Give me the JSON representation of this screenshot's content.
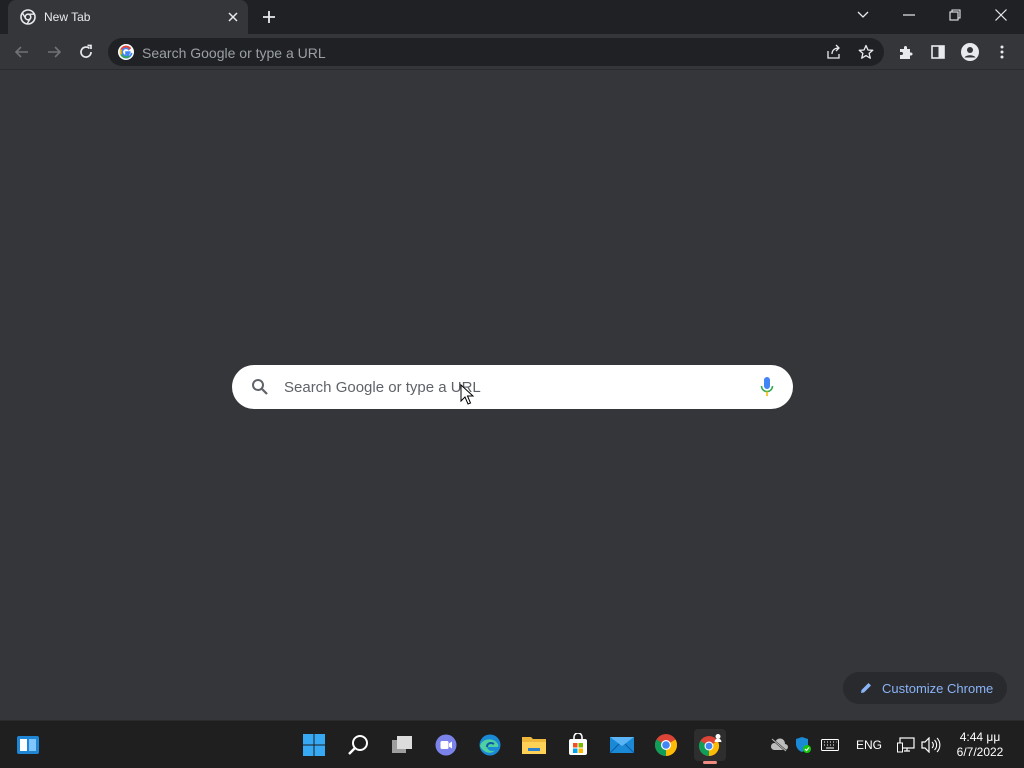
{
  "browser": {
    "tab": {
      "title": "New Tab",
      "favicon": "chrome-icon"
    },
    "omnibox": {
      "placeholder": "Search Google or type a URL"
    },
    "window_controls": [
      "chevron-down-icon",
      "minimize-icon",
      "restore-icon",
      "close-icon"
    ]
  },
  "ntp": {
    "search_placeholder": "Search Google or type a URL",
    "customize_label": "Customize Chrome"
  },
  "taskbar": {
    "apps": [
      "start-icon",
      "search-icon",
      "task-view-icon",
      "teams-chat-icon",
      "edge-icon",
      "file-explorer-icon",
      "store-icon",
      "mail-icon",
      "chrome-icon",
      "chrome-profile-icon"
    ],
    "language": "ENG",
    "time": "4:44 μμ",
    "date": "6/7/2022"
  },
  "colors": {
    "accent": "#8ab4f8",
    "page_bg": "#35363a",
    "frame_bg": "#202124"
  }
}
